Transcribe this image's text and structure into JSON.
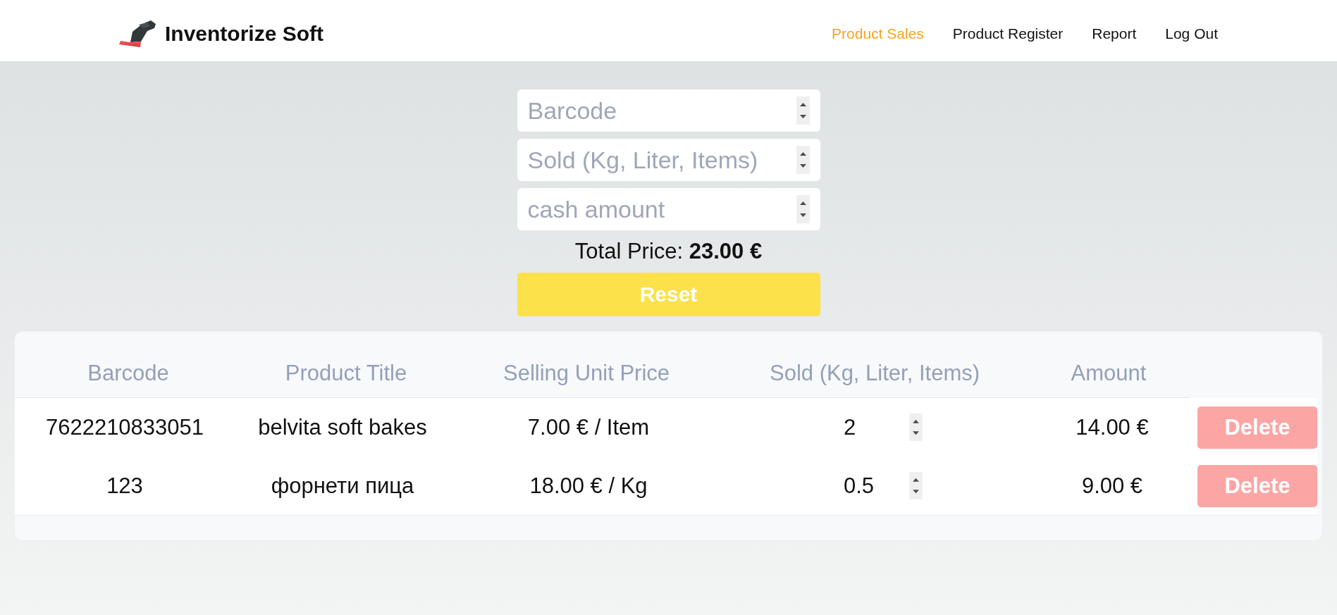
{
  "header": {
    "brand": "Inventorize Soft",
    "nav": [
      {
        "label": "Product Sales",
        "selected": true
      },
      {
        "label": "Product Register",
        "selected": false
      },
      {
        "label": "Report",
        "selected": false
      },
      {
        "label": "Log Out",
        "selected": false
      }
    ]
  },
  "sale_form": {
    "fields": [
      {
        "placeholder": "Barcode"
      },
      {
        "placeholder": "Sold (Kg, Liter, Items)"
      },
      {
        "placeholder": "cash amount"
      }
    ],
    "total": "Total Price: **23.00 €**",
    "reset_button": "Reset"
  },
  "table": {
    "columns": [
      "Barcode",
      "Product Title",
      "Selling Unit Price",
      "Sold (Kg, Liter, Items)",
      "Amount"
    ],
    "rows": [
      {
        "barcode": "7622210833051",
        "product_title": "belvita soft bakes",
        "selling_unit_price": "7.00 € / Item",
        "sold": "2",
        "amount": "14.00 €",
        "delete_button": "Delete"
      },
      {
        "barcode": "123",
        "product_title": "форнети пица",
        "selling_unit_price": "18.00 € / Kg",
        "sold": "0.5",
        "amount": "9.00 €",
        "delete_button": "Delete"
      }
    ]
  }
}
